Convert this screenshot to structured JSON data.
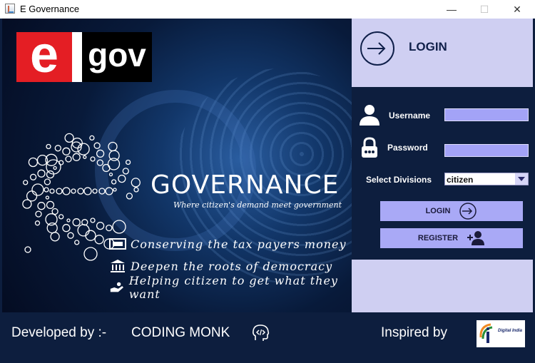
{
  "window": {
    "title": "E Governance",
    "minimize_glyph": "—",
    "maximize_glyph": "☐",
    "close_glyph": "✕"
  },
  "logo": {
    "e": "e",
    "gov": "gov"
  },
  "brand": {
    "title": "GOVERNANCE",
    "tagline": "Where citizen's demand meet government"
  },
  "bullets": [
    {
      "icon": "money-icon",
      "text": "Conserving the tax payers money"
    },
    {
      "icon": "building-icon",
      "text": "Deepen the roots of democracy"
    },
    {
      "icon": "helping-hand-icon",
      "text": "Helping citizen to get what they want"
    }
  ],
  "login_panel": {
    "header": "LOGIN",
    "username_label": "Username",
    "username_value": "",
    "password_label": "Password",
    "password_value": "",
    "division_label": "Select Divisions",
    "division_selected": "citizen",
    "login_button": "LOGIN",
    "register_button": "REGISTER"
  },
  "footer": {
    "developed_by": "Developed by :-",
    "developer": "CODING MONK",
    "inspired_by": "Inspired by",
    "inspired_logo_text": "Digital India"
  },
  "colors": {
    "background": "#0d1e3e",
    "panel_light": "#cfcff2",
    "input_fill": "#a3a3f7",
    "button_fill": "#a9a9f6",
    "logo_red": "#e41e24"
  }
}
